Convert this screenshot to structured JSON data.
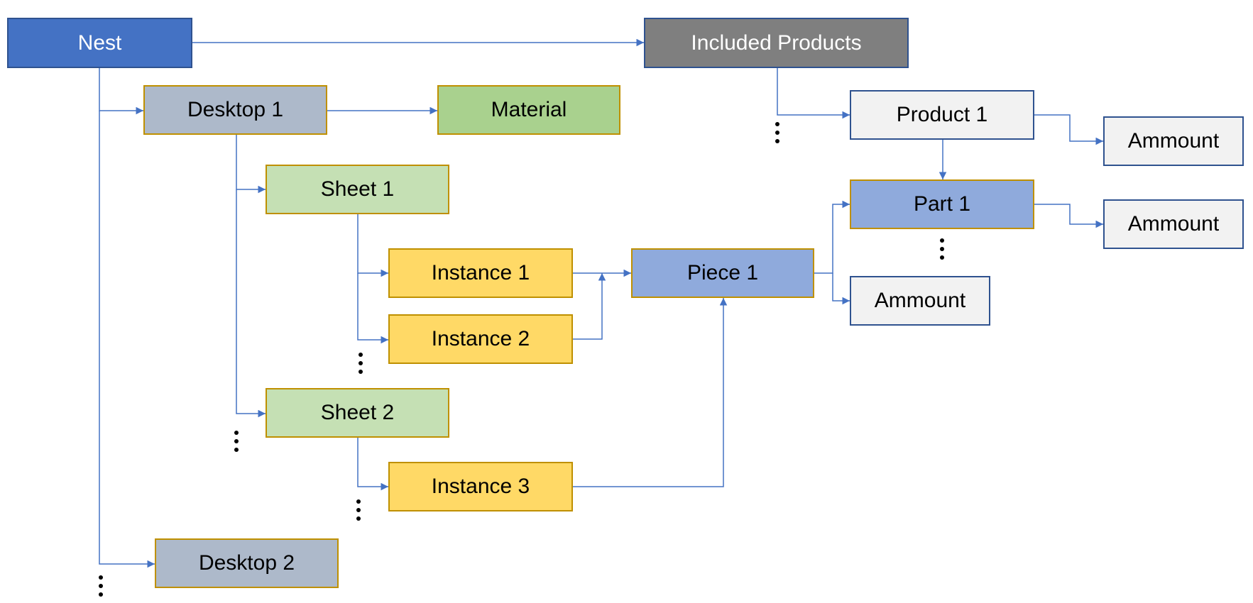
{
  "diagram": {
    "colors": {
      "connector": "#4472c4",
      "gold_border": "#bf9000",
      "navy_border": "#2f528f"
    },
    "nodes": [
      {
        "id": "nest",
        "label": "Nest",
        "fill": "#4472c4",
        "border": "#2f528f",
        "text_color": "#ffffff"
      },
      {
        "id": "included-products",
        "label": "Included Products",
        "fill": "#7f7f7f",
        "border": "#2f528f",
        "text_color": "#ffffff"
      },
      {
        "id": "desktop-1",
        "label": "Desktop 1",
        "fill": "#adb9ca",
        "border": "#bf9000",
        "text_color": "#000000"
      },
      {
        "id": "material",
        "label": "Material",
        "fill": "#a9d18e",
        "border": "#bf9000",
        "text_color": "#000000"
      },
      {
        "id": "product-1",
        "label": "Product 1",
        "fill": "#f2f2f2",
        "border": "#2f528f",
        "text_color": "#000000"
      },
      {
        "id": "ammount-product",
        "label": "Ammount",
        "fill": "#f2f2f2",
        "border": "#2f528f",
        "text_color": "#000000"
      },
      {
        "id": "sheet-1",
        "label": "Sheet 1",
        "fill": "#c5e0b4",
        "border": "#bf9000",
        "text_color": "#000000"
      },
      {
        "id": "part-1",
        "label": "Part 1",
        "fill": "#8faadc",
        "border": "#bf9000",
        "text_color": "#000000"
      },
      {
        "id": "ammount-part",
        "label": "Ammount",
        "fill": "#f2f2f2",
        "border": "#2f528f",
        "text_color": "#000000"
      },
      {
        "id": "instance-1",
        "label": "Instance 1",
        "fill": "#ffd966",
        "border": "#bf9000",
        "text_color": "#000000"
      },
      {
        "id": "piece-1",
        "label": "Piece 1",
        "fill": "#8faadc",
        "border": "#bf9000",
        "text_color": "#000000"
      },
      {
        "id": "ammount-piece",
        "label": "Ammount",
        "fill": "#f2f2f2",
        "border": "#2f528f",
        "text_color": "#000000"
      },
      {
        "id": "instance-2",
        "label": "Instance 2",
        "fill": "#ffd966",
        "border": "#bf9000",
        "text_color": "#000000"
      },
      {
        "id": "sheet-2",
        "label": "Sheet 2",
        "fill": "#c5e0b4",
        "border": "#bf9000",
        "text_color": "#000000"
      },
      {
        "id": "instance-3",
        "label": "Instance 3",
        "fill": "#ffd966",
        "border": "#bf9000",
        "text_color": "#000000"
      },
      {
        "id": "desktop-2",
        "label": "Desktop 2",
        "fill": "#adb9ca",
        "border": "#bf9000",
        "text_color": "#000000"
      }
    ],
    "edges": [
      {
        "from": "nest",
        "to": "included-products"
      },
      {
        "from": "nest",
        "to": "desktop-1"
      },
      {
        "from": "nest",
        "to": "desktop-2"
      },
      {
        "from": "desktop-1",
        "to": "material"
      },
      {
        "from": "desktop-1",
        "to": "sheet-1"
      },
      {
        "from": "desktop-1",
        "to": "sheet-2"
      },
      {
        "from": "sheet-1",
        "to": "instance-1"
      },
      {
        "from": "sheet-1",
        "to": "instance-2"
      },
      {
        "from": "sheet-2",
        "to": "instance-3"
      },
      {
        "from": "instance-1",
        "to": "piece-1"
      },
      {
        "from": "instance-2",
        "to": "piece-1"
      },
      {
        "from": "instance-3",
        "to": "piece-1"
      },
      {
        "from": "piece-1",
        "to": "part-1"
      },
      {
        "from": "piece-1",
        "to": "ammount-piece"
      },
      {
        "from": "included-products",
        "to": "product-1"
      },
      {
        "from": "product-1",
        "to": "ammount-product"
      },
      {
        "from": "product-1",
        "to": "part-1"
      },
      {
        "from": "part-1",
        "to": "ammount-part"
      }
    ],
    "ellipses": [
      {
        "id": "more-products",
        "meaning": "more products"
      },
      {
        "id": "more-parts",
        "meaning": "more parts"
      },
      {
        "id": "more-instances-sheet-1",
        "meaning": "more instances"
      },
      {
        "id": "more-sheets",
        "meaning": "more sheets"
      },
      {
        "id": "more-instances-sheet-2",
        "meaning": "more instances"
      },
      {
        "id": "more-desktops",
        "meaning": "more desktops"
      }
    ]
  }
}
